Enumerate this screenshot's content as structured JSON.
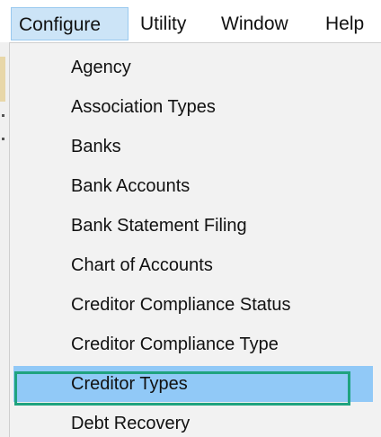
{
  "menubar": {
    "items": [
      {
        "label": "Configure",
        "active": true
      },
      {
        "label": "Utility"
      },
      {
        "label": "Window"
      },
      {
        "label": "Help"
      }
    ]
  },
  "dropdown": {
    "items": [
      {
        "label": "Agency"
      },
      {
        "label": "Association Types"
      },
      {
        "label": "Banks"
      },
      {
        "label": "Bank Accounts"
      },
      {
        "label": "Bank Statement Filing"
      },
      {
        "label": "Chart of Accounts"
      },
      {
        "label": "Creditor Compliance Status"
      },
      {
        "label": "Creditor Compliance Type"
      },
      {
        "label": "Creditor Types",
        "highlighted": true
      },
      {
        "label": "Debt Recovery"
      }
    ]
  },
  "colors": {
    "menu_active_bg": "#cce4f7",
    "item_highlight_bg": "#91c9f7",
    "focus_outline": "#1fa37f",
    "dropdown_bg": "#f2f2f2"
  }
}
